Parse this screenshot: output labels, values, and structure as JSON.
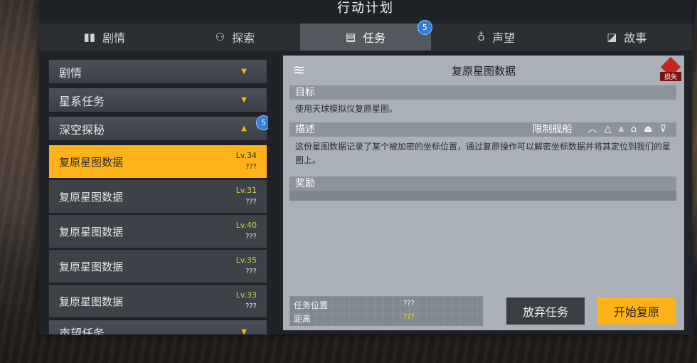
{
  "window": {
    "title": "行动计划"
  },
  "tabs": [
    {
      "label": "剧情",
      "icon": "book-icon"
    },
    {
      "label": "探索",
      "icon": "explore-icon"
    },
    {
      "label": "任务",
      "icon": "document-icon",
      "badge": "5"
    },
    {
      "label": "声望",
      "icon": "reputation-icon"
    },
    {
      "label": "故事",
      "icon": "story-icon"
    }
  ],
  "sidebar": {
    "categories": [
      {
        "label": "剧情"
      },
      {
        "label": "星系任务"
      },
      {
        "label": "深空探秘",
        "badge": "5"
      },
      {
        "label": "声望任务"
      }
    ],
    "missions": [
      {
        "name": "复原星图数据",
        "level": "Lv.34",
        "progress": "???"
      },
      {
        "name": "复原星图数据",
        "level": "Lv.31",
        "progress": "???"
      },
      {
        "name": "复原星图数据",
        "level": "Lv.40",
        "progress": "???"
      },
      {
        "name": "复原星图数据",
        "level": "Lv.35",
        "progress": "???"
      },
      {
        "name": "复原星图数据",
        "level": "Lv.33",
        "progress": "???"
      }
    ]
  },
  "detail": {
    "title": "复原星图数据",
    "lost_label": "损失",
    "objective_header": "目标",
    "objective_text": "使用天球模拟仪复原星图。",
    "description_header": "描述",
    "restricted_ships_label": "限制舰船",
    "description_text": "这份星图数据记录了某个被加密的坐标位置，通过复原操作可以解密坐标数据并将其定位到我们的星图上。",
    "reward_header": "奖励",
    "location_label": "任务位置",
    "location_value": "???",
    "distance_label": "距离",
    "distance_value": "???",
    "abandon_button": "放弃任务",
    "start_button": "开始复原"
  },
  "colors": {
    "accent": "#ffb21a",
    "badge": "#2f7fd8",
    "panel": "#a9b0b8"
  }
}
